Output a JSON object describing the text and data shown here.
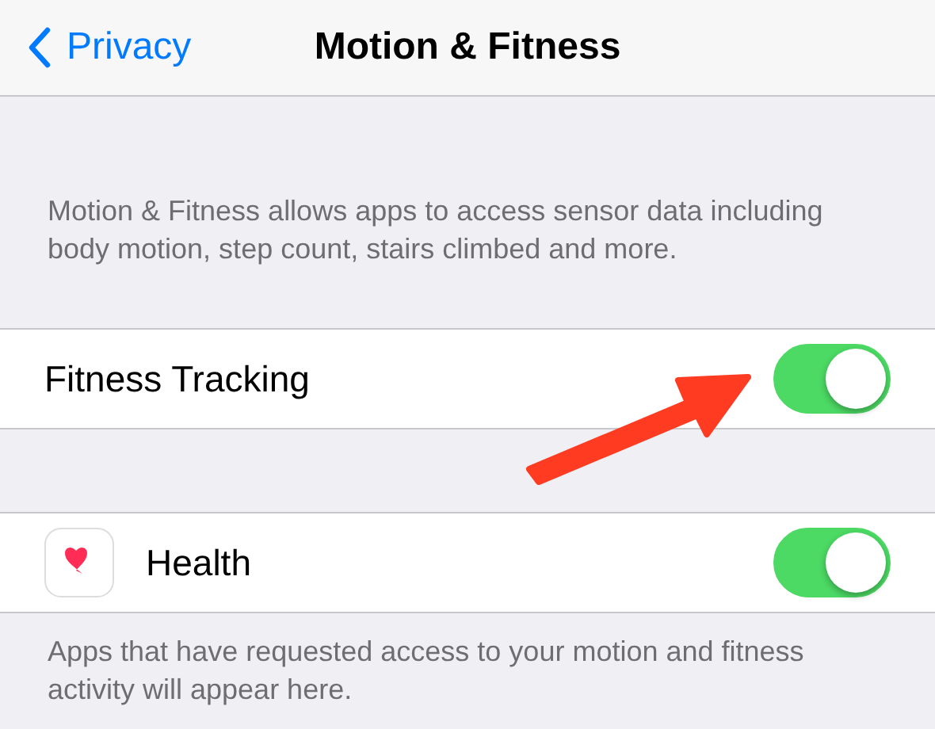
{
  "nav": {
    "back": "Privacy",
    "title": "Motion & Fitness"
  },
  "description": "Motion & Fitness allows apps to access sensor data including body motion, step count, stairs climbed and more.",
  "groups": [
    {
      "rows": [
        {
          "label": "Fitness Tracking",
          "on": true,
          "icon": false
        }
      ]
    },
    {
      "rows": [
        {
          "label": "Health",
          "on": true,
          "icon": true
        }
      ],
      "footer": "Apps that have requested access to your motion and fitness activity will appear here."
    }
  ]
}
